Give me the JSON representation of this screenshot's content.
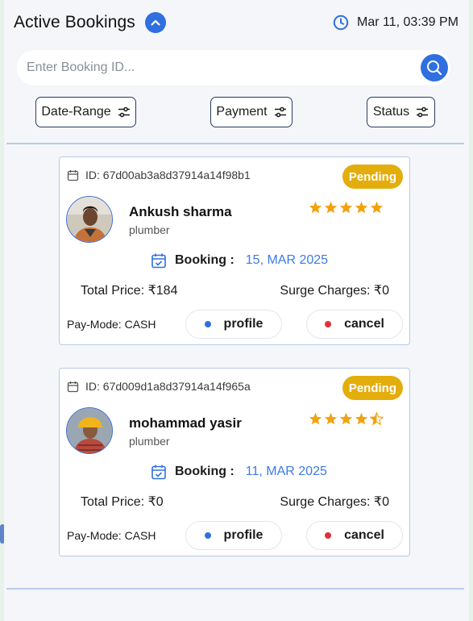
{
  "header": {
    "title": "Active Bookings",
    "datetime": "Mar 11, 03:39 PM"
  },
  "search": {
    "placeholder": "Enter Booking ID..."
  },
  "filters": [
    "Date-Range",
    "Payment",
    "Status"
  ],
  "colors": {
    "accent": "#2f6fe0",
    "pending": "#e3ad0b",
    "profile_dot": "#2f6fe0",
    "cancel_dot": "#e0303a",
    "star": "#f2a20f"
  },
  "bookings": [
    {
      "id_text": "ID: 67d00ab3a8d37914a14f98b1",
      "status": "Pending",
      "name": "Ankush sharma",
      "role": "plumber",
      "rating": 5,
      "booking_label": "Booking :",
      "booking_date": "15, MAR 2025",
      "total_price": "Total Price: ₹184",
      "surge": "Surge Charges: ₹0",
      "pay_mode": "Pay-Mode: CASH",
      "profile_label": "profile",
      "cancel_label": "cancel"
    },
    {
      "id_text": "ID: 67d009d1a8d37914a14f965a",
      "status": "Pending",
      "name": "mohammad yasir",
      "role": "plumber",
      "rating": 4.5,
      "booking_label": "Booking :",
      "booking_date": "11, MAR 2025",
      "total_price": "Total Price: ₹0",
      "surge": "Surge Charges: ₹0",
      "pay_mode": "Pay-Mode: CASH",
      "profile_label": "profile",
      "cancel_label": "cancel"
    }
  ]
}
